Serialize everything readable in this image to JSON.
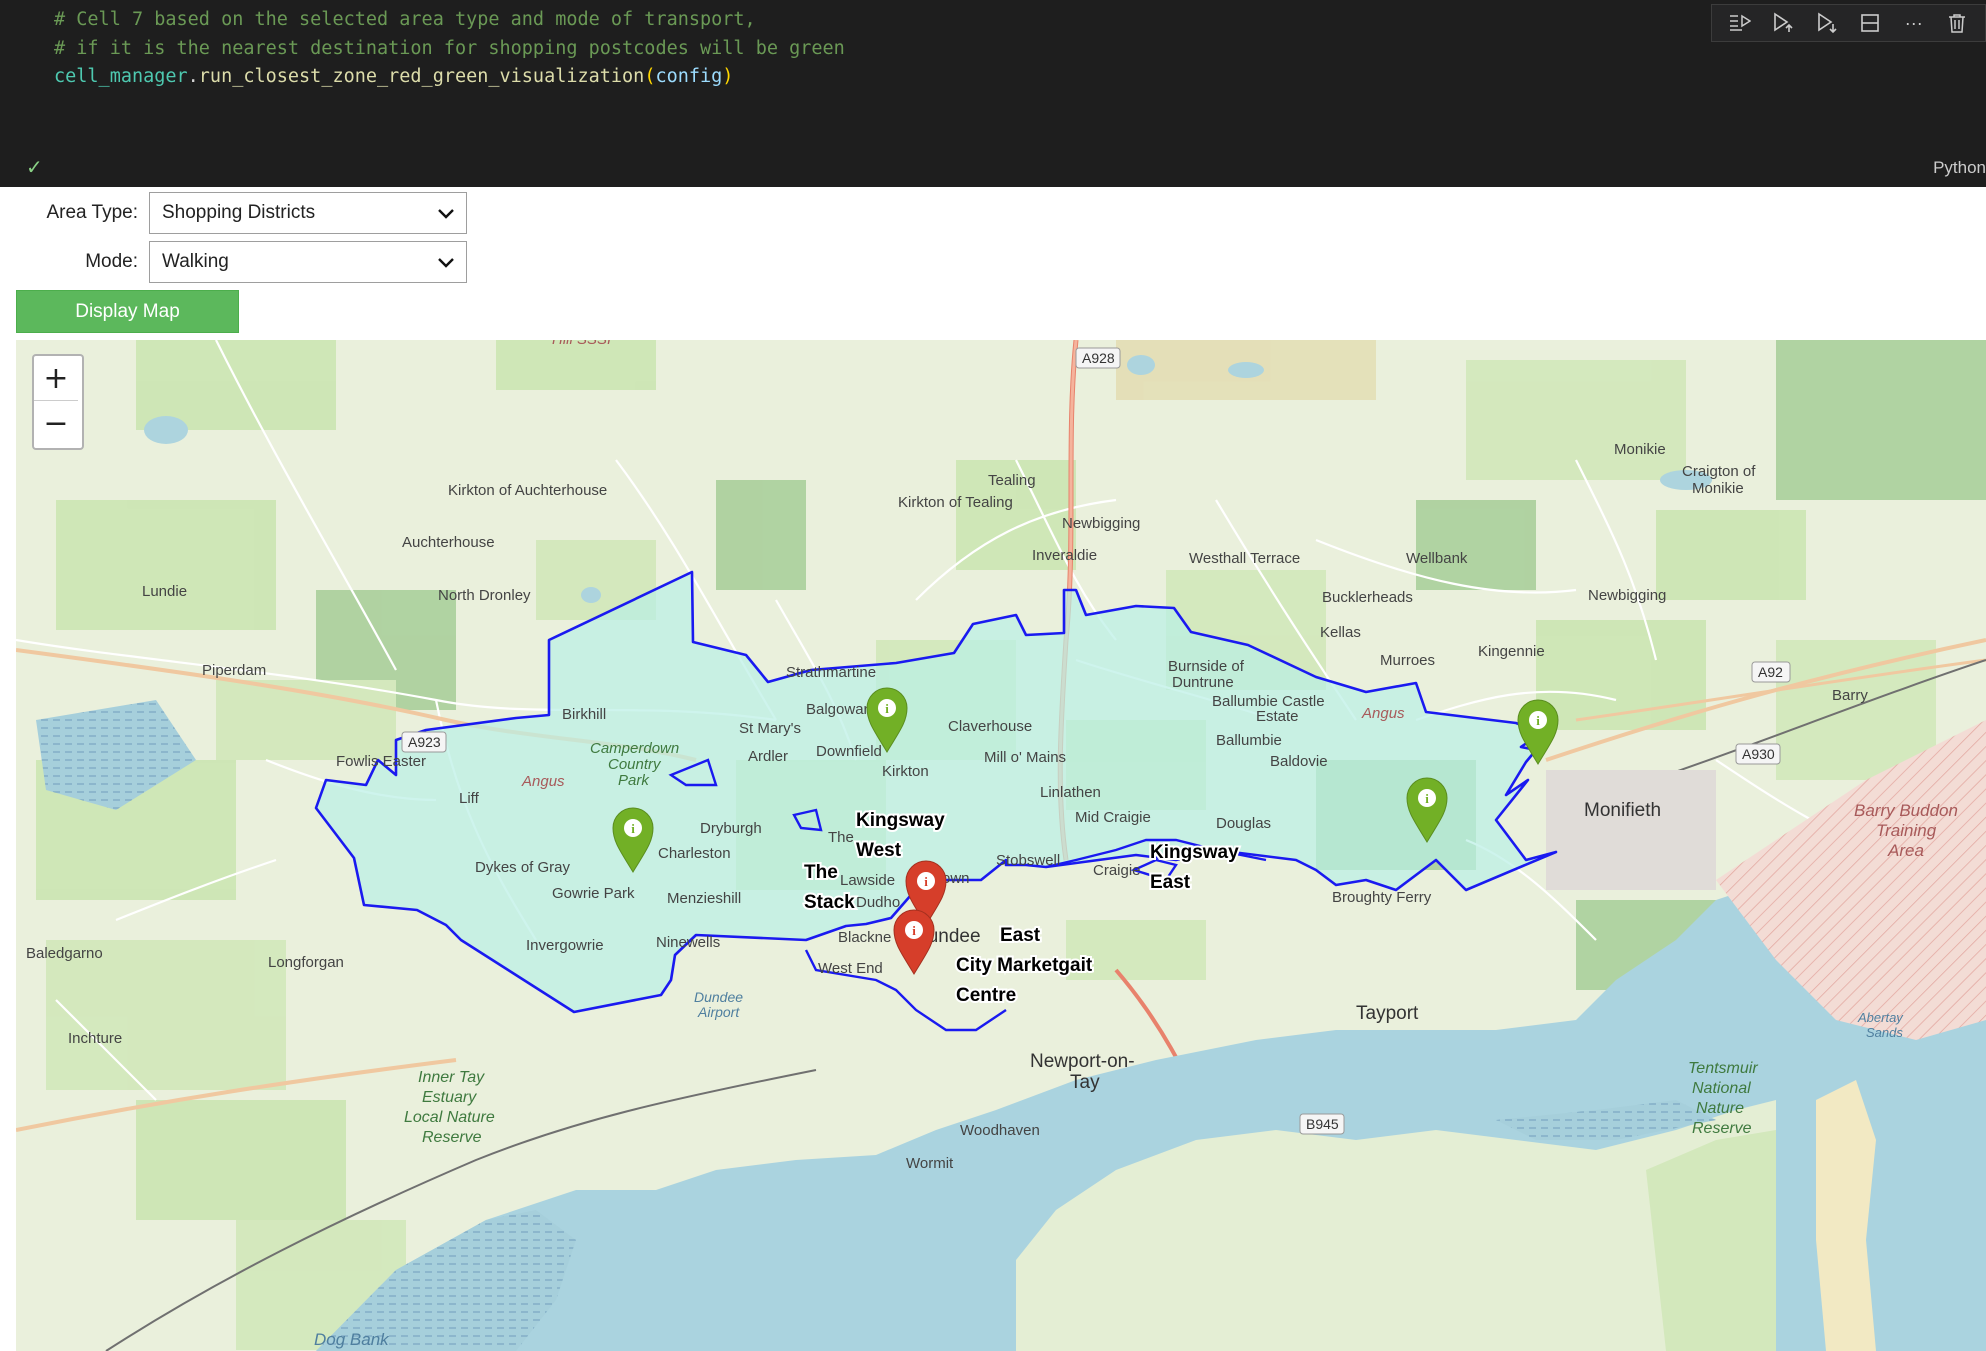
{
  "code_cell": {
    "comment_line_1": "# Cell 7 based on the selected area type and mode of transport,",
    "comment_line_2": "# if it is the nearest destination for shopping postcodes will be green",
    "code_obj": "cell_manager",
    "code_dot": ".",
    "code_func": "run_closest_zone_red_green_visualization",
    "code_open": "(",
    "code_arg": "config",
    "code_close": ")",
    "status": "✓",
    "kernel": "Python"
  },
  "toolbar": {
    "icons": [
      "run-by-line-icon",
      "execute-above-icon",
      "execute-below-icon",
      "split-cell-icon",
      "more-icon",
      "delete-icon"
    ],
    "more_glyph": "···"
  },
  "widgets": {
    "area_type_label": "Area Type:",
    "area_type_value": "Shopping Districts",
    "mode_label": "Mode:",
    "mode_value": "Walking",
    "display_button": "Display Map"
  },
  "map": {
    "zoom_in": "+",
    "zoom_out": "−",
    "colors": {
      "boundary": "#1a1af0",
      "zone_fill": "#b9f0e6",
      "water": "#aad3df",
      "marker_green": "#72b026",
      "marker_red": "#d63e2a"
    },
    "places": {
      "hill_sssi": "Hill SSSI",
      "kirkton_auchterhouse": "Kirkton of Auchterhouse",
      "auchterhouse": "Auchterhouse",
      "lundie": "Lundie",
      "north_dronley": "North Dronley",
      "tealing": "Tealing",
      "kirkton_tealing": "Kirkton of Tealing",
      "newbigging1": "Newbigging",
      "inveraldie": "Inveraldie",
      "westhall": "Westhall Terrace",
      "wellbank": "Wellbank",
      "monikie": "Monikie",
      "craigton1": "Craigton of",
      "craigton2": "Monikie",
      "newbigging2": "Newbigging",
      "buckler": "Bucklerheads",
      "kellas": "Kellas",
      "murroes": "Murroes",
      "kingennie": "Kingennie",
      "piperdam": "Piperdam",
      "strathmartine": "Strathmartine",
      "burnside1": "Burnside of",
      "burnside2": "Duntrune",
      "ballumbie_castle1": "Ballumbie Castle",
      "ballumbie_castle2": "Estate",
      "barry": "Barry",
      "birkhill": "Birkhill",
      "balgowan": "Balgowan",
      "st_marys": "St Mary's",
      "claverhouse": "Claverhouse",
      "ballumbie": "Ballumbie",
      "fowlis": "Fowlis Easter",
      "ardler": "Ardler",
      "downfield": "Downfield",
      "kirkton": "Kirkton",
      "mill_o_mains": "Mill o' Mains",
      "baldovie": "Baldovie",
      "monifieth": "Monifieth",
      "liff": "Liff",
      "linlathen": "Linlathen",
      "dryburgh": "Dryburgh",
      "mid_craigie": "Mid Craigie",
      "douglas": "Douglas",
      "charleston": "Charleston",
      "the": "The",
      "dykes": "Dykes of Gray",
      "stobswell": "Stobswell",
      "craigie": "Craigie",
      "lawside": "Lawside",
      "hilltown": "Hilltown",
      "gowrie": "Gowrie Park",
      "menzieshill": "Menzieshill",
      "dudhope": "Dudho",
      "broughty": "Broughty Ferry",
      "invergowrie": "Invergowrie",
      "ninewells": "Ninewells",
      "blackness": "Blackne",
      "dundee": "Dundee",
      "baledgarno": "Baledgarno",
      "longforgan": "Longforgan",
      "west_end": "West End",
      "tayport": "Tayport",
      "inchture": "Inchture",
      "newport1": "Newport-on-",
      "newport2": "Tay",
      "woodhaven": "Woodhaven",
      "wormit": "Wormit",
      "dog_bank": "Dog Bank",
      "angus1": "Angus",
      "angus2": "Angus",
      "camperdown1": "Camperdown",
      "camperdown2": "Country",
      "camperdown3": "Park",
      "dundee_airport1": "Dundee",
      "dundee_airport2": "Airport",
      "barry_buddon1": "Barry Buddon",
      "barry_buddon2": "Training",
      "barry_buddon3": "Area",
      "inner_tay1": "Inner Tay",
      "inner_tay2": "Estuary",
      "inner_tay3": "Local Nature",
      "inner_tay4": "Reserve",
      "tentsmuir1": "Tentsmuir",
      "tentsmuir2": "National",
      "tentsmuir3": "Nature",
      "tentsmuir4": "Reserve",
      "abertay1": "Abertay",
      "abertay2": "Sands"
    },
    "roads": {
      "a928": "A928",
      "a923": "A923",
      "a92": "A92",
      "a930": "A930",
      "b945": "B945"
    },
    "zones": {
      "kingsway_west_1": "Kingsway",
      "kingsway_west_2": "West",
      "kingsway_east_1": "Kingsway",
      "kingsway_east_2": "East",
      "the_stack_1": "The",
      "the_stack_2": "Stack",
      "east": "East",
      "city_1": "City Marketgait",
      "city_2": "Centre"
    },
    "markers": [
      {
        "name": "green-marker-kirkton",
        "color": "green"
      },
      {
        "name": "green-marker-charleston",
        "color": "green"
      },
      {
        "name": "green-marker-broughty",
        "color": "green"
      },
      {
        "name": "green-marker-monifieth",
        "color": "green"
      },
      {
        "name": "red-marker-hilltown",
        "color": "red"
      },
      {
        "name": "red-marker-city",
        "color": "red"
      }
    ],
    "marker_glyph": "i"
  }
}
